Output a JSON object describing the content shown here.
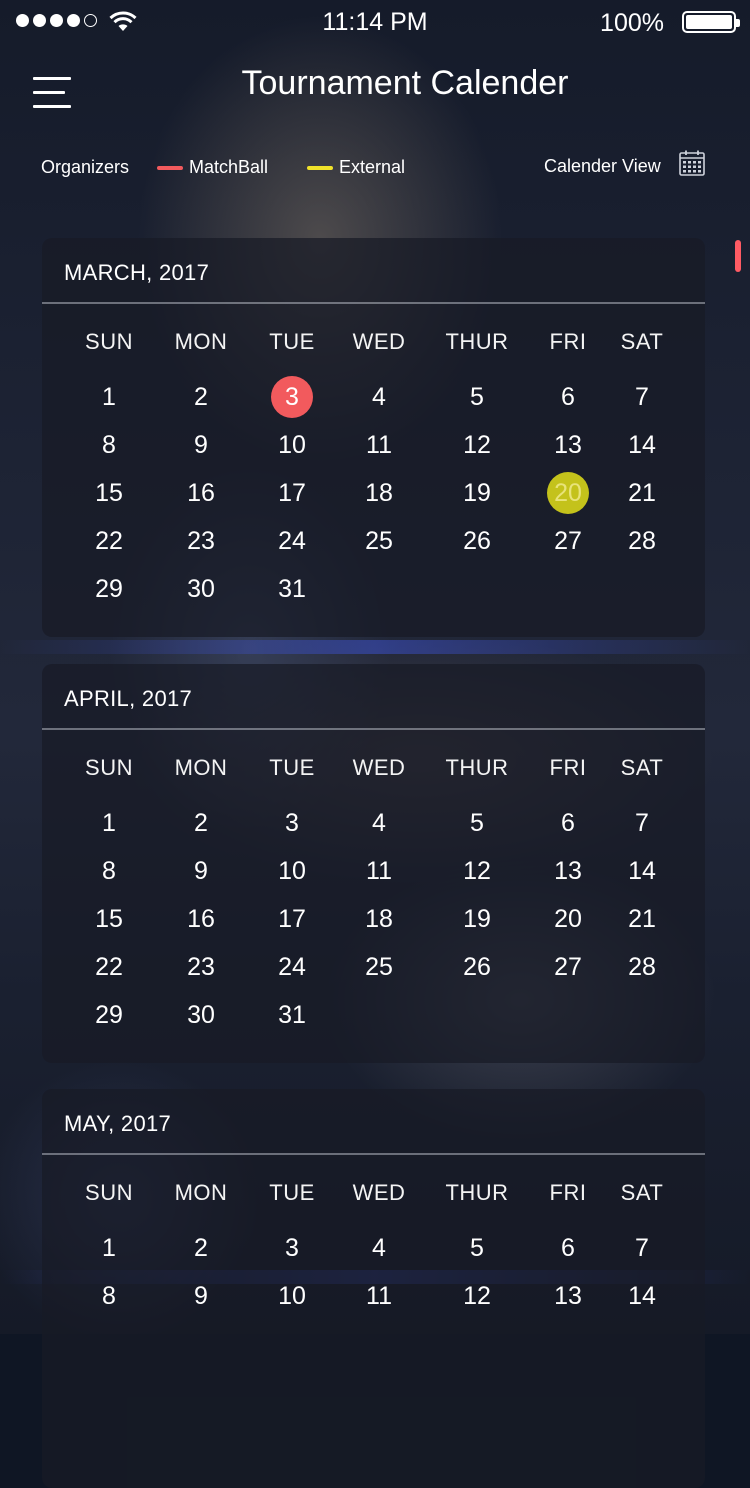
{
  "status_bar": {
    "time": "11:14 PM",
    "battery": "100%",
    "signal_bars_filled": 4,
    "signal_bars_total": 5
  },
  "header": {
    "title": "Tournament Calender",
    "menu_icon": "hamburger-menu-icon"
  },
  "legend": {
    "organizers_label": "Organizers",
    "items": [
      {
        "label": "MatchBall",
        "color": "#f25a5d"
      },
      {
        "label": "External",
        "color": "#f0e22a"
      }
    ],
    "view_label": "Calender View",
    "view_icon": "calendar-icon"
  },
  "weekdays": [
    "SUN",
    "MON",
    "TUE",
    "WED",
    "THUR",
    "FRI",
    "SAT"
  ],
  "months": [
    {
      "title": "MARCH, 2017",
      "weeks": [
        [
          "1",
          "2",
          "3",
          "4",
          "5",
          "6",
          "7"
        ],
        [
          "8",
          "9",
          "10",
          "11",
          "12",
          "13",
          "14"
        ],
        [
          "15",
          "16",
          "17",
          "18",
          "19",
          "20",
          "21"
        ],
        [
          "22",
          "23",
          "24",
          "25",
          "26",
          "27",
          "28"
        ],
        [
          "29",
          "30",
          "31",
          "",
          "",
          "",
          ""
        ]
      ],
      "highlights": {
        "3": "matchball",
        "20": "external"
      }
    },
    {
      "title": "APRIL, 2017",
      "weeks": [
        [
          "1",
          "2",
          "3",
          "4",
          "5",
          "6",
          "7"
        ],
        [
          "8",
          "9",
          "10",
          "11",
          "12",
          "13",
          "14"
        ],
        [
          "15",
          "16",
          "17",
          "18",
          "19",
          "20",
          "21"
        ],
        [
          "22",
          "23",
          "24",
          "25",
          "26",
          "27",
          "28"
        ],
        [
          "29",
          "30",
          "31",
          "",
          "",
          "",
          ""
        ]
      ],
      "highlights": {}
    },
    {
      "title": "MAY, 2017",
      "weeks": [
        [
          "1",
          "2",
          "3",
          "4",
          "5",
          "6",
          "7"
        ],
        [
          "8",
          "9",
          "10",
          "11",
          "12",
          "13",
          "14"
        ]
      ],
      "highlights": {}
    }
  ],
  "colors": {
    "matchball": "#f25a5d",
    "external": "#c4c21b",
    "scroll_indicator": "#ff5b64"
  }
}
